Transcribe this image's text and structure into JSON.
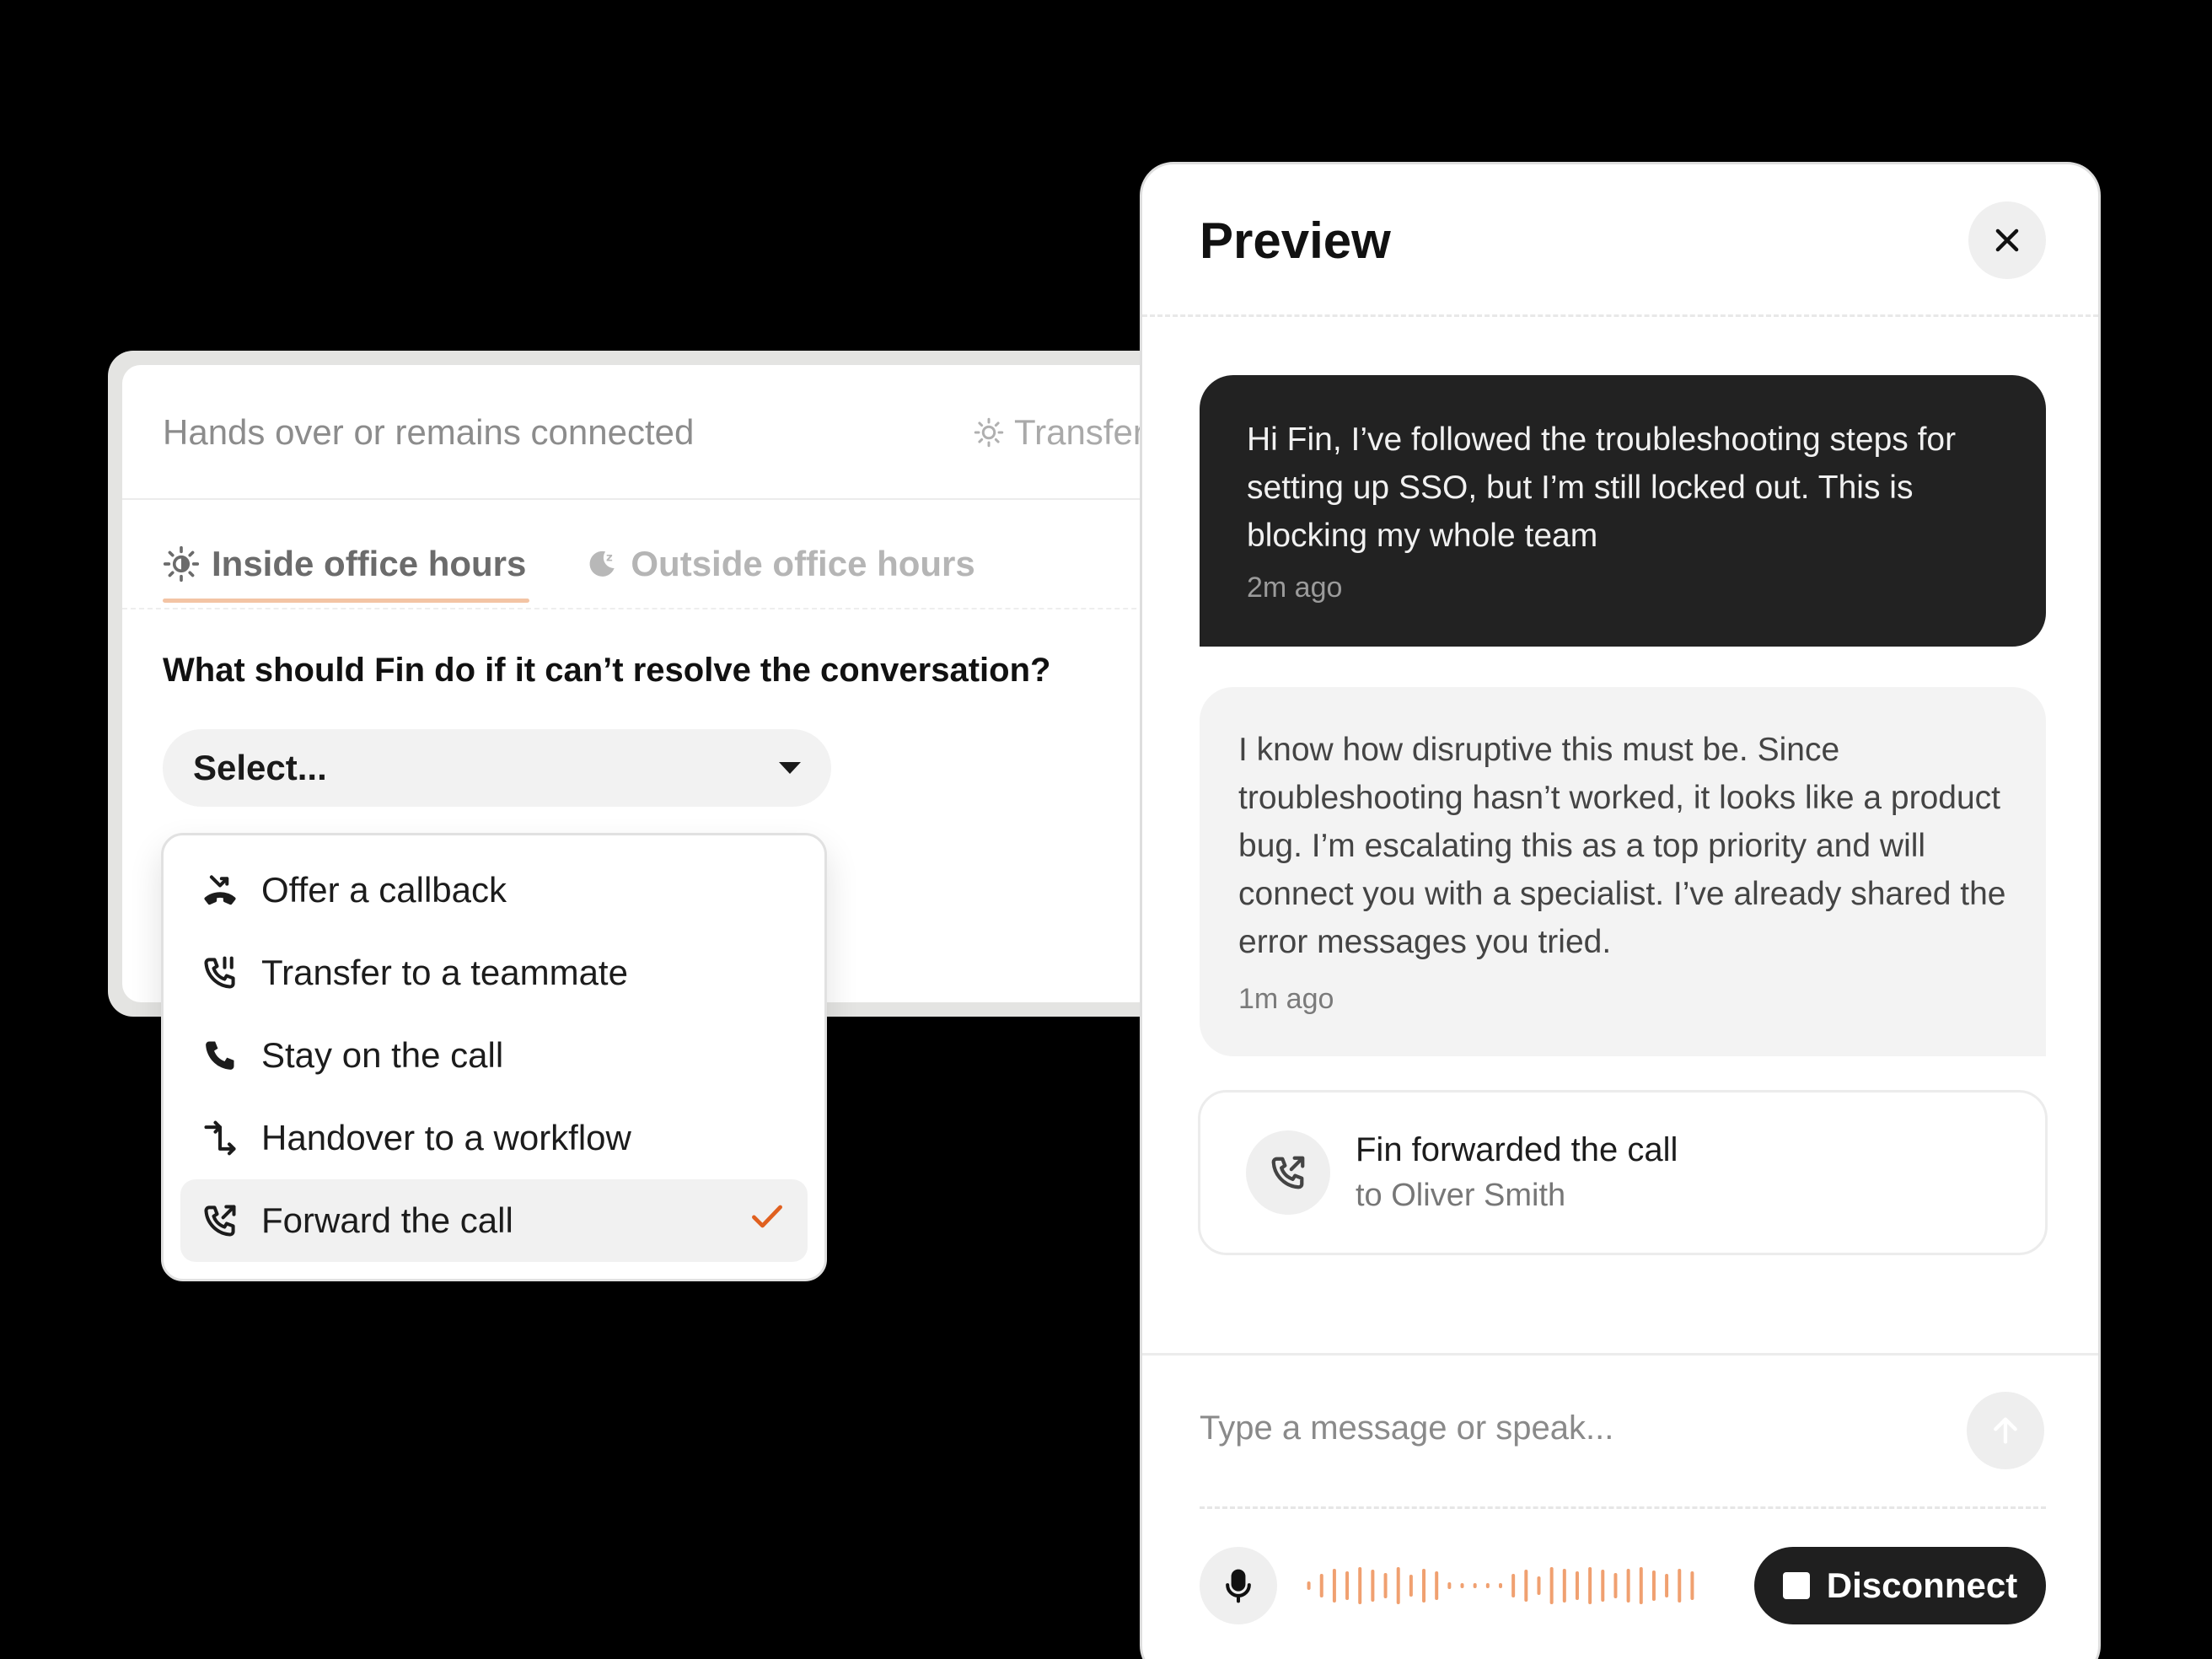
{
  "settings": {
    "header_title": "Hands over or remains connected",
    "header_status": "Transfer",
    "tabs": [
      {
        "label": "Inside office hours",
        "icon": "sun-icon"
      },
      {
        "label": "Outside office hours",
        "icon": "moon-icon"
      }
    ],
    "question": "What should Fin do if it can’t resolve the conversation?",
    "select_placeholder": "Select...",
    "options": [
      {
        "label": "Offer a callback",
        "icon": "callback-icon"
      },
      {
        "label": "Transfer to a teammate",
        "icon": "transfer-call-icon"
      },
      {
        "label": "Stay on the call",
        "icon": "phone-icon"
      },
      {
        "label": "Handover to a workflow",
        "icon": "workflow-icon"
      },
      {
        "label": "Forward the call",
        "icon": "forward-call-icon",
        "selected": true
      }
    ]
  },
  "preview": {
    "title": "Preview",
    "messages": [
      {
        "from": "user",
        "text": "Hi Fin, I’ve followed the troubleshooting steps for setting up SSO, but I’m still locked out. This is blocking my whole team",
        "time": "2m ago"
      },
      {
        "from": "fin",
        "text": "I know how disruptive this must be. Since troubleshooting hasn’t worked, it looks like a product bug. I’m escalating this as a top priority and will connect you with a specialist. I’ve already shared the error messages you tried.",
        "time": "1m ago"
      }
    ],
    "event": {
      "title": "Fin forwarded the call",
      "subtitle": "to Oliver Smith"
    },
    "input_placeholder": "Type a message or speak...",
    "disconnect_label": "Disconnect"
  },
  "colors": {
    "accent": "#e0601f",
    "waveform": "#f0a070",
    "tab_underline": "#f3c4a4",
    "user_bubble": "#222222"
  }
}
